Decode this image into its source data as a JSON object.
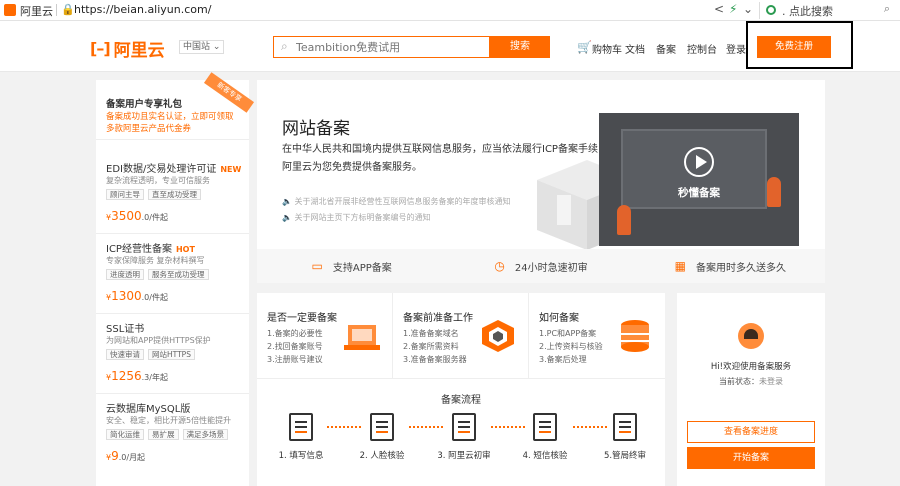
{
  "browser": {
    "tab_title": "阿里云",
    "url": "https://beian.aliyun.com/",
    "search_text": ". 点此搜索"
  },
  "header": {
    "logo_text": "阿里云",
    "region": "中国站",
    "search_placeholder": "Teambition免费试用",
    "search_button": "搜索",
    "nav": [
      "购物车",
      "文档",
      "备案",
      "控制台",
      "登录"
    ],
    "register_button": "免费注册"
  },
  "sidebar": {
    "gift_title": "备案用户专享礼包",
    "gift_desc": "备案成功且实名认证，立即可领取多款阿里云产品代金券",
    "ribbon": "新客专享",
    "products": [
      {
        "name": "EDI数据/交易处理许可证",
        "badge": "NEW",
        "desc": "复杂流程透明，专业可信服务",
        "tags": [
          "顾问主导",
          "直至成功受理"
        ],
        "price": "3500",
        "unit": ".0/件起"
      },
      {
        "name": "ICP经营性备案",
        "badge": "HOT",
        "desc": "专家保障服务 复杂材料撰写",
        "tags": [
          "进度透明",
          "服务至成功受理"
        ],
        "price": "1300",
        "unit": ".0/件起"
      },
      {
        "name": "SSL证书",
        "badge": "",
        "desc": "为网站和APP提供HTTPS保护",
        "tags": [
          "快速审请",
          "网站HTTPS"
        ],
        "price": "1256",
        "unit": ".3/年起"
      },
      {
        "name": "云数据库MySQL版",
        "badge": "",
        "desc": "安全、稳定，相比开源5倍性能提升",
        "tags": [
          "简化运维",
          "易扩展",
          "满足多场景"
        ],
        "price": "9",
        "unit": ".0/月起"
      }
    ]
  },
  "hero": {
    "title": "网站备案",
    "desc": "在中华人民共和国境内提供互联网信息服务，应当依法履行ICP备案手续，阿里云为您免费提供备案服务。",
    "notices": [
      "关于湖北省开展非经营性互联网信息服务备案的年度审核通知",
      "关于网站主页下方标明备案编号的通知"
    ],
    "video_label": "秒懂备案"
  },
  "features": [
    "支持APP备案",
    "24小时急速初审",
    "备案用时多久送多久"
  ],
  "cards": [
    {
      "title": "是否一定要备案",
      "lines": [
        "1.备案的必要性",
        "2.找回备案账号",
        "3.注册账号建议"
      ]
    },
    {
      "title": "备案前准备工作",
      "lines": [
        "1.准备备案域名",
        "2.备案所需资料",
        "3.准备备案服务器"
      ]
    },
    {
      "title": "如何备案",
      "lines": [
        "1.PC和APP备案",
        "2.上传资料与核验",
        "3.备案后处理"
      ]
    }
  ],
  "flow": {
    "title": "备案流程",
    "steps": [
      "1. 填写信息",
      "2. 人脸核验",
      "3. 阿里云初审",
      "4. 短信核验",
      "5.管局终审"
    ]
  },
  "user_panel": {
    "welcome": "Hi!欢迎使用备案服务",
    "status_label": "当前状态：",
    "status_value": "未登录",
    "progress_button": "查看备案进度",
    "start_button": "开始备案"
  },
  "colors": {
    "brand": "#ff6a00"
  }
}
